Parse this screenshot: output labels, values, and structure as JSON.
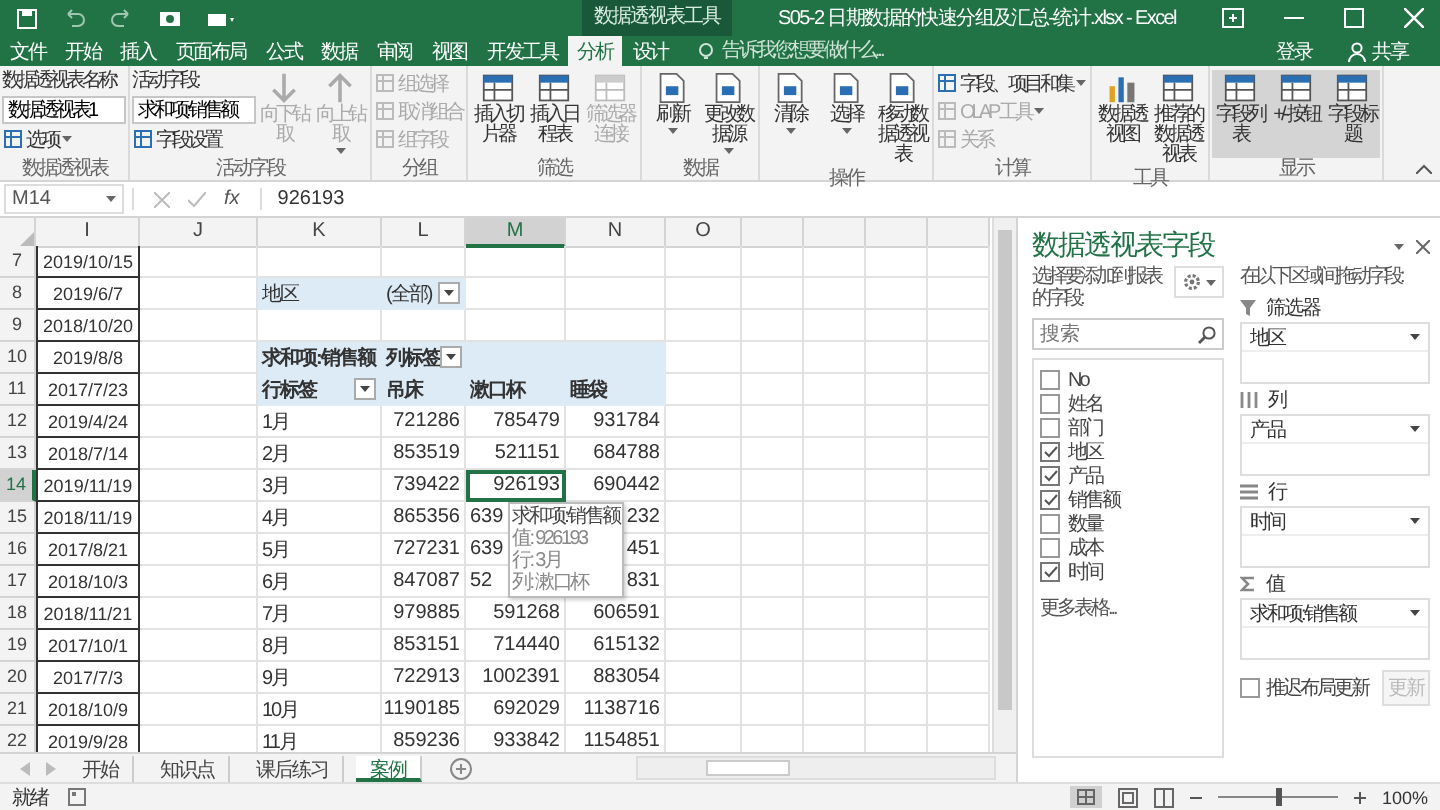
{
  "window": {
    "context": "数据透视表工具",
    "title": "S05-2 日期数据的快速分组及汇总-统计.xlsx - Excel"
  },
  "tabs": [
    {
      "label": "文件",
      "selected": false
    },
    {
      "label": "开始",
      "selected": false
    },
    {
      "label": "插入",
      "selected": false
    },
    {
      "label": "页面布局",
      "selected": false
    },
    {
      "label": "公式",
      "selected": false
    },
    {
      "label": "数据",
      "selected": false
    },
    {
      "label": "审阅",
      "selected": false
    },
    {
      "label": "视图",
      "selected": false
    },
    {
      "label": "开发工具",
      "selected": false
    },
    {
      "label": "分析",
      "selected": true
    },
    {
      "label": "设计",
      "selected": false
    }
  ],
  "tell_me": {
    "placeholder": "告诉我您想要做什么..."
  },
  "sign_in": "登录",
  "share": "共享",
  "ribbon": [
    {
      "label": "数据透视表",
      "cols": [
        {
          "kind": "stack",
          "items": [
            {
              "kind": "caption",
              "text": "数据透视表名称:"
            },
            {
              "kind": "input",
              "text": "数据透视表1"
            },
            {
              "kind": "button",
              "text": "选项",
              "menu": true,
              "disabled": false
            }
          ]
        }
      ]
    },
    {
      "label": "活动字段",
      "cols": [
        {
          "kind": "stack",
          "items": [
            {
              "kind": "caption",
              "text": "活动字段:"
            },
            {
              "kind": "input",
              "text": "求和项:销售额"
            },
            {
              "kind": "button",
              "text": "字段设置",
              "menu": false,
              "disabled": false
            }
          ]
        },
        {
          "kind": "large",
          "text": "向下钻取",
          "disabled": true,
          "menu": false,
          "selected": false
        },
        {
          "kind": "large",
          "text": "向上钻取",
          "disabled": true,
          "menu": true,
          "selected": false
        }
      ]
    },
    {
      "label": "分组",
      "cols": [
        {
          "kind": "stack",
          "items": [
            {
              "kind": "button",
              "text": "组选择",
              "menu": false,
              "disabled": true
            },
            {
              "kind": "button",
              "text": "取消组合",
              "menu": false,
              "disabled": true
            },
            {
              "kind": "button",
              "text": "组字段",
              "menu": false,
              "disabled": true
            }
          ]
        }
      ]
    },
    {
      "label": "筛选",
      "cols": [
        {
          "kind": "large",
          "text": "插入切片器",
          "disabled": false,
          "menu": false,
          "selected": false
        },
        {
          "kind": "large",
          "text": "插入日程表",
          "disabled": false,
          "menu": false,
          "selected": false
        },
        {
          "kind": "large",
          "text": "筛选器连接",
          "disabled": true,
          "menu": false,
          "selected": false
        }
      ]
    },
    {
      "label": "数据",
      "cols": [
        {
          "kind": "large",
          "text": "刷新",
          "disabled": false,
          "menu": true,
          "selected": false
        },
        {
          "kind": "large",
          "text": "更改数据源",
          "disabled": false,
          "menu": true,
          "selected": false
        }
      ]
    },
    {
      "label": "操作",
      "cols": [
        {
          "kind": "large",
          "text": "清除",
          "disabled": false,
          "menu": true,
          "selected": false
        },
        {
          "kind": "large",
          "text": "选择",
          "disabled": false,
          "menu": true,
          "selected": false
        },
        {
          "kind": "large",
          "text": "移动数据透视表",
          "disabled": false,
          "menu": false,
          "selected": false
        }
      ]
    },
    {
      "label": "计算",
      "cols": [
        {
          "kind": "stack",
          "items": [
            {
              "kind": "button",
              "text": "字段、项目和集",
              "menu": true,
              "disabled": false
            },
            {
              "kind": "button",
              "text": "OLAP 工具",
              "menu": true,
              "disabled": true
            },
            {
              "kind": "button",
              "text": "关系",
              "menu": false,
              "disabled": true
            }
          ]
        }
      ]
    },
    {
      "label": "工具",
      "cols": [
        {
          "kind": "large",
          "text": "数据透视图",
          "disabled": false,
          "menu": false,
          "selected": false
        },
        {
          "kind": "large",
          "text": "推荐的数据透视表",
          "disabled": false,
          "menu": false,
          "selected": false
        }
      ]
    },
    {
      "label": "显示",
      "cols": [
        {
          "kind": "large",
          "text": "字段列表",
          "disabled": false,
          "menu": false,
          "selected": true
        },
        {
          "kind": "large",
          "text": "+/- 按钮",
          "disabled": false,
          "menu": false,
          "selected": true
        },
        {
          "kind": "large",
          "text": "字段标题",
          "disabled": false,
          "menu": false,
          "selected": true
        }
      ]
    }
  ],
  "formula_bar": {
    "name_box": "M14",
    "function_label": "fx",
    "value": "926193"
  },
  "columns": [
    {
      "label": "I",
      "selected": false
    },
    {
      "label": "J",
      "selected": false
    },
    {
      "label": "K",
      "selected": false
    },
    {
      "label": "L",
      "selected": false
    },
    {
      "label": "M",
      "selected": true
    },
    {
      "label": "N",
      "selected": false
    },
    {
      "label": "O",
      "selected": false
    }
  ],
  "rows": [
    {
      "row": "7",
      "date": "2019/10/15",
      "selected": false,
      "kind": "blank",
      "cells": []
    },
    {
      "row": "8",
      "date": "2019/6/7",
      "selected": false,
      "kind": "filter",
      "cells": [
        {
          "kind": "label",
          "text": "地区"
        },
        {
          "kind": "dropdown",
          "text": "(全部)"
        }
      ]
    },
    {
      "row": "9",
      "date": "2018/10/20",
      "selected": false,
      "kind": "blank",
      "cells": []
    },
    {
      "row": "10",
      "date": "2019/8/8",
      "selected": false,
      "kind": "header",
      "cells": [
        {
          "kind": "label",
          "text": "求和项:销售额"
        },
        {
          "kind": "dropdown",
          "text": "列标签"
        }
      ]
    },
    {
      "row": "11",
      "date": "2017/7/23",
      "selected": false,
      "kind": "header",
      "cells": [
        {
          "kind": "dropdown",
          "text": "行标签"
        },
        {
          "kind": "label",
          "text": "吊床"
        },
        {
          "kind": "label",
          "text": "漱口杯"
        },
        {
          "kind": "label",
          "text": "睡袋"
        }
      ]
    },
    {
      "row": "12",
      "date": "2019/4/24",
      "selected": false,
      "kind": "data",
      "cells": [
        {
          "kind": "label",
          "text": "1月"
        },
        {
          "kind": "number",
          "text": "721286"
        },
        {
          "kind": "number",
          "text": "785479"
        },
        {
          "kind": "number",
          "text": "931784"
        }
      ]
    },
    {
      "row": "13",
      "date": "2018/7/14",
      "selected": false,
      "kind": "data",
      "cells": [
        {
          "kind": "label",
          "text": "2月"
        },
        {
          "kind": "number",
          "text": "853519"
        },
        {
          "kind": "number",
          "text": "521151"
        },
        {
          "kind": "number",
          "text": "684788"
        }
      ]
    },
    {
      "row": "14",
      "date": "2019/11/19",
      "selected": true,
      "kind": "data",
      "cells": [
        {
          "kind": "label",
          "text": "3月"
        },
        {
          "kind": "number",
          "text": "739422"
        },
        {
          "kind": "number",
          "text": "926193"
        },
        {
          "kind": "number",
          "text": "690442"
        }
      ]
    },
    {
      "row": "15",
      "date": "2018/11/19",
      "selected": false,
      "kind": "data",
      "cells": [
        {
          "kind": "label",
          "text": "4月"
        },
        {
          "kind": "number",
          "text": "865356"
        },
        {
          "kind": "partial",
          "text": "639"
        },
        {
          "kind": "number",
          "text": "232"
        }
      ]
    },
    {
      "row": "16",
      "date": "2017/8/21",
      "selected": false,
      "kind": "data",
      "cells": [
        {
          "kind": "label",
          "text": "5月"
        },
        {
          "kind": "number",
          "text": "727231"
        },
        {
          "kind": "partial",
          "text": "639"
        },
        {
          "kind": "number",
          "text": "451"
        }
      ]
    },
    {
      "row": "17",
      "date": "2018/10/3",
      "selected": false,
      "kind": "data",
      "cells": [
        {
          "kind": "label",
          "text": "6月"
        },
        {
          "kind": "number",
          "text": "847087"
        },
        {
          "kind": "partial",
          "text": "52"
        },
        {
          "kind": "number",
          "text": "831"
        }
      ]
    },
    {
      "row": "18",
      "date": "2018/11/21",
      "selected": false,
      "kind": "data",
      "cells": [
        {
          "kind": "label",
          "text": "7月"
        },
        {
          "kind": "number",
          "text": "979885"
        },
        {
          "kind": "number",
          "text": "591268"
        },
        {
          "kind": "number",
          "text": "606591"
        }
      ]
    },
    {
      "row": "19",
      "date": "2017/10/1",
      "selected": false,
      "kind": "data",
      "cells": [
        {
          "kind": "label",
          "text": "8月"
        },
        {
          "kind": "number",
          "text": "853151"
        },
        {
          "kind": "number",
          "text": "714440"
        },
        {
          "kind": "number",
          "text": "615132"
        }
      ]
    },
    {
      "row": "20",
      "date": "2017/7/3",
      "selected": false,
      "kind": "data",
      "cells": [
        {
          "kind": "label",
          "text": "9月"
        },
        {
          "kind": "number",
          "text": "722913"
        },
        {
          "kind": "number",
          "text": "1002391"
        },
        {
          "kind": "number",
          "text": "883054"
        }
      ]
    },
    {
      "row": "21",
      "date": "2018/10/9",
      "selected": false,
      "kind": "data",
      "cells": [
        {
          "kind": "label",
          "text": "10月"
        },
        {
          "kind": "number",
          "text": "1190185"
        },
        {
          "kind": "number",
          "text": "692029"
        },
        {
          "kind": "number",
          "text": "1138716"
        }
      ]
    },
    {
      "row": "22",
      "date": "2019/9/28",
      "selected": false,
      "kind": "data",
      "cells": [
        {
          "kind": "label",
          "text": "11月"
        },
        {
          "kind": "number",
          "text": "859236"
        },
        {
          "kind": "number",
          "text": "933842"
        },
        {
          "kind": "number",
          "text": "1154851"
        }
      ]
    }
  ],
  "tooltip": {
    "lines": [
      "求和项:销售额",
      "值: 926193",
      "行: 3月",
      "列: 漱口杯"
    ]
  },
  "sheet_tabs": [
    {
      "label": "开始",
      "selected": false
    },
    {
      "label": "知识点",
      "selected": false
    },
    {
      "label": "课后练习",
      "selected": false
    },
    {
      "label": "案例",
      "selected": true
    }
  ],
  "status": {
    "text": "就绪",
    "zoom": {
      "level": 0.5,
      "reading": "100%"
    }
  },
  "pane": {
    "title": "数据透视表字段",
    "choose_label": "选择要添加到报表的字段:",
    "search": {
      "placeholder": "搜索"
    },
    "fields": [
      {
        "label": "No",
        "checked": false
      },
      {
        "label": "姓名",
        "checked": false
      },
      {
        "label": "部门",
        "checked": false
      },
      {
        "label": "地区",
        "checked": true
      },
      {
        "label": "产品",
        "checked": true
      },
      {
        "label": "销售额",
        "checked": true
      },
      {
        "label": "数量",
        "checked": false
      },
      {
        "label": "成本",
        "checked": false
      },
      {
        "label": "时间",
        "checked": true
      }
    ],
    "more_tables": "更多表格...",
    "drag_label": "在以下区域间拖动字段:",
    "areas": [
      {
        "kind": "filter",
        "label": "筛选器",
        "items": [
          "地区"
        ]
      },
      {
        "kind": "columns",
        "label": "列",
        "items": [
          "产品"
        ]
      },
      {
        "kind": "rows",
        "label": "行",
        "items": [
          "时间"
        ]
      },
      {
        "kind": "values",
        "label": "值",
        "items": [
          "求和项:销售额"
        ]
      }
    ],
    "defer": {
      "label": "推迟布局更新",
      "checked": false
    },
    "update_button": {
      "label": "更新",
      "disabled": true
    }
  }
}
